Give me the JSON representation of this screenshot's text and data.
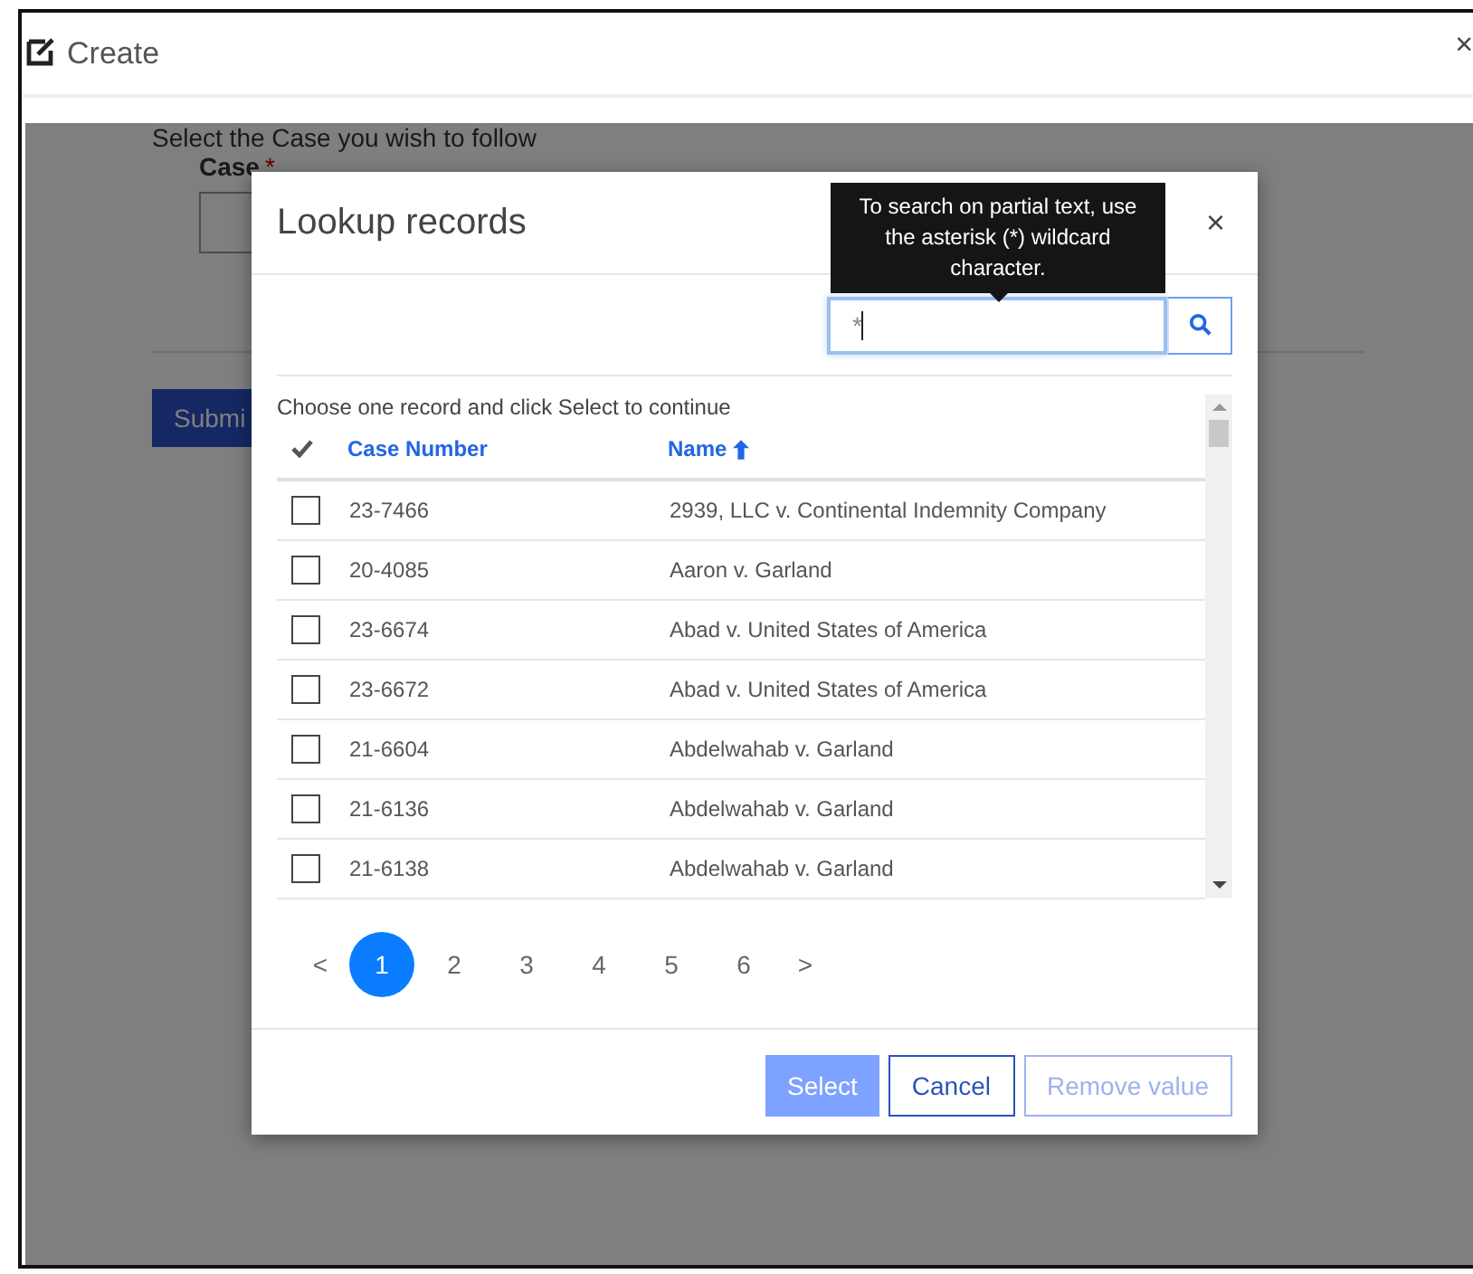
{
  "window": {
    "title": "Create",
    "close": "×"
  },
  "form": {
    "prompt": "Select the Case you wish to follow",
    "field_label": "Case",
    "required_mark": "*",
    "submit": "Submi"
  },
  "dialog": {
    "title": "Lookup records",
    "close": "×",
    "tooltip": "To search on partial text, use the asterisk (*) wildcard character.",
    "search": {
      "value": "*"
    },
    "instruction": "Choose one record and click Select to continue",
    "columns": [
      {
        "label": "Case Number",
        "sorted": false
      },
      {
        "label": "Name",
        "sorted": true
      }
    ],
    "rows": [
      {
        "case_number": "23-7466",
        "name": "2939, LLC v. Continental Indemnity Company",
        "selected": false
      },
      {
        "case_number": "20-4085",
        "name": "Aaron v. Garland",
        "selected": false
      },
      {
        "case_number": "23-6674",
        "name": "Abad v. United States of America",
        "selected": false
      },
      {
        "case_number": "23-6672",
        "name": "Abad v. United States of America",
        "selected": false
      },
      {
        "case_number": "21-6604",
        "name": "Abdelwahab v. Garland",
        "selected": false
      },
      {
        "case_number": "21-6136",
        "name": "Abdelwahab v. Garland",
        "selected": false
      },
      {
        "case_number": "21-6138",
        "name": "Abdelwahab v. Garland",
        "selected": false
      }
    ],
    "pagination": {
      "prev": "<",
      "next": ">",
      "pages": [
        {
          "label": "1",
          "selected": true
        },
        {
          "label": "2",
          "selected": false
        },
        {
          "label": "3",
          "selected": false
        },
        {
          "label": "4",
          "selected": false
        },
        {
          "label": "5",
          "selected": false
        },
        {
          "label": "6",
          "selected": false
        }
      ]
    },
    "buttons": [
      {
        "label": "Select",
        "kind": "primary"
      },
      {
        "label": "Cancel",
        "kind": "secondary"
      },
      {
        "label": "Remove value",
        "kind": "disabled"
      }
    ]
  }
}
